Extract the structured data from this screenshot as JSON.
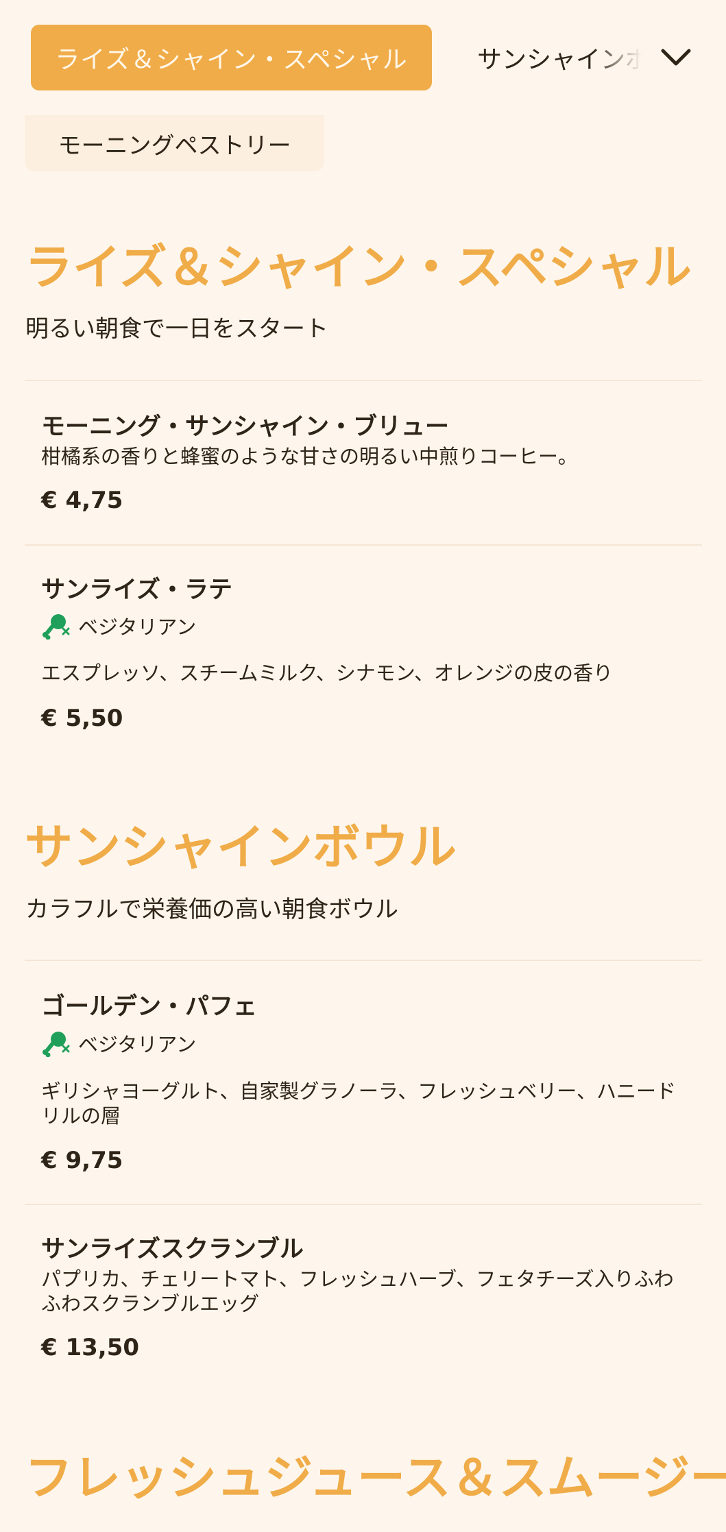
{
  "nav": {
    "active_tab": "ライズ＆シャイン・スペシャル",
    "next_tab": "サンシャインボウル",
    "prev_tab": "モーニングペストリー"
  },
  "sections": [
    {
      "title": "ライズ＆シャイン・スペシャル",
      "subtitle": "明るい朝食で一日をスタート",
      "items": [
        {
          "name": "モーニング・サンシャイン・ブリュー",
          "description": "柑橘系の香りと蜂蜜のような甘さの明るい中煎りコーヒー。",
          "price": "€ 4,75"
        },
        {
          "name": "サンライズ・ラテ",
          "tag": "ベジタリアン",
          "description": "エスプレッソ、スチームミルク、シナモン、オレンジの皮の香り",
          "price": "€ 5,50"
        }
      ]
    },
    {
      "title": "サンシャインボウル",
      "subtitle": "カラフルで栄養価の高い朝食ボウル",
      "items": [
        {
          "name": "ゴールデン・パフェ",
          "tag": "ベジタリアン",
          "description": "ギリシャヨーグルト、自家製グラノーラ、フレッシュベリー、ハニードリルの層",
          "price": "€ 9,75"
        },
        {
          "name": "サンライズスクランブル",
          "description": "パプリカ、チェリートマト、フレッシュハーブ、フェタチーズ入りふわふわスクランブルエッグ",
          "price": "€ 13,50"
        }
      ]
    },
    {
      "title": "フレッシュジュース＆スムージー"
    }
  ],
  "colors": {
    "accent": "#f0ac48",
    "background": "#fef6ec",
    "text": "#2f2418",
    "veg_icon": "#1fa05a"
  },
  "icons": {
    "dropdown": "chevron-down-icon",
    "vegetarian": "meat-crossed-icon"
  }
}
